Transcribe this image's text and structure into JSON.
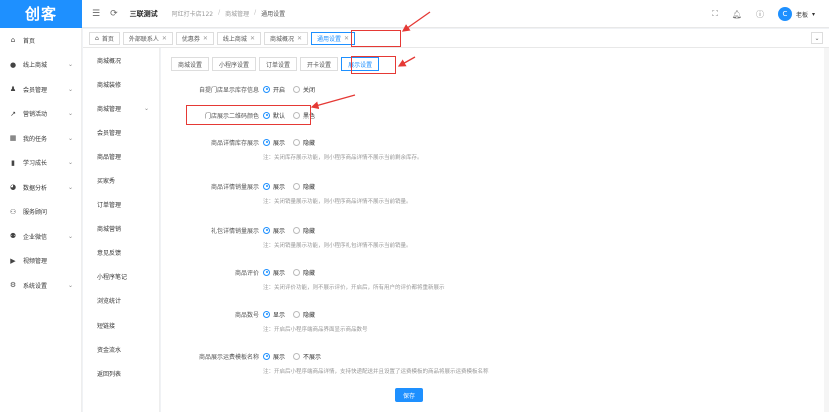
{
  "app": {
    "logo": "创客",
    "tenant": "三联测试"
  },
  "breadcrumb": [
    "阿红打卡店122",
    "商城管理",
    "通用设置"
  ],
  "user": {
    "avatar": "C",
    "name": "老板"
  },
  "sidebar": {
    "items": [
      {
        "label": "首页",
        "icon": "home-icon",
        "arrow": false
      },
      {
        "label": "线上商城",
        "icon": "shop-icon",
        "arrow": true
      },
      {
        "label": "会员管理",
        "icon": "user-icon",
        "arrow": true
      },
      {
        "label": "营销活动",
        "icon": "chart-icon",
        "arrow": true
      },
      {
        "label": "我的任务",
        "icon": "grid-icon",
        "arrow": true
      },
      {
        "label": "学习成长",
        "icon": "book-icon",
        "arrow": true
      },
      {
        "label": "数据分析",
        "icon": "pie-icon",
        "arrow": true
      },
      {
        "label": "服务顾问",
        "icon": "group-icon",
        "arrow": false
      },
      {
        "label": "企业微信",
        "icon": "team-icon",
        "arrow": true
      },
      {
        "label": "视频管理",
        "icon": "video-icon",
        "arrow": false
      },
      {
        "label": "系统设置",
        "icon": "gear-icon",
        "arrow": true
      }
    ]
  },
  "submenu": {
    "items": [
      {
        "label": "商城概况",
        "arrow": false
      },
      {
        "label": "商城装修",
        "arrow": false
      },
      {
        "label": "商城管理",
        "arrow": true
      },
      {
        "label": "会员管理",
        "arrow": false
      },
      {
        "label": "商品管理",
        "arrow": false
      },
      {
        "label": "买家秀",
        "arrow": false
      },
      {
        "label": "订单管理",
        "arrow": false
      },
      {
        "label": "商城营销",
        "arrow": false
      },
      {
        "label": "意见反馈",
        "arrow": false
      },
      {
        "label": "小程序笔记",
        "arrow": false
      },
      {
        "label": "浏览统计",
        "arrow": false
      },
      {
        "label": "短链接",
        "arrow": false
      },
      {
        "label": "资金流水",
        "arrow": false
      },
      {
        "label": "返回列表",
        "arrow": false
      }
    ]
  },
  "tabs": [
    {
      "label": "首页",
      "icon": "home-icon",
      "closable": false,
      "active": false
    },
    {
      "label": "外部联系人",
      "closable": true,
      "active": false
    },
    {
      "label": "优惠券",
      "closable": true,
      "active": false
    },
    {
      "label": "线上商城",
      "closable": true,
      "active": false
    },
    {
      "label": "商城概况",
      "closable": true,
      "active": false
    },
    {
      "label": "通用设置",
      "closable": true,
      "active": true
    }
  ],
  "subtabs": [
    {
      "label": "商城设置",
      "active": false
    },
    {
      "label": "小程序设置",
      "active": false
    },
    {
      "label": "订单设置",
      "active": false
    },
    {
      "label": "开卡设置",
      "active": false
    },
    {
      "label": "展示设置",
      "active": true
    }
  ],
  "settings": [
    {
      "label": "自提门店显示库存信息",
      "options": [
        "开启",
        "关闭"
      ],
      "selected": 0,
      "note": ""
    },
    {
      "label": "门店展示二维码颜色",
      "options": [
        "默认",
        "黑色"
      ],
      "selected": 0,
      "note": ""
    },
    {
      "label": "商品详情库存展示",
      "options": [
        "展示",
        "隐藏"
      ],
      "selected": 0,
      "note": "注：关闭库存展示功能，则小程序商品详情不展示当前剩余库存。"
    },
    {
      "label": "商品详情销量展示",
      "options": [
        "展示",
        "隐藏"
      ],
      "selected": 0,
      "note": "注：关闭销量展示功能，则小程序商品详情不展示当前销量。"
    },
    {
      "label": "礼包详情销量展示",
      "options": [
        "展示",
        "隐藏"
      ],
      "selected": 0,
      "note": "注：关闭销量展示功能，则小程序礼包详情不展示当前销量。"
    },
    {
      "label": "商品评价",
      "options": [
        "展示",
        "隐藏"
      ],
      "selected": 0,
      "note": "注：关闭评价功能，则不展示评价，开启后，所有用户的评价都将重新展示"
    },
    {
      "label": "商品数号",
      "options": [
        "显示",
        "隐藏"
      ],
      "selected": 0,
      "note": "注：开启后小程序端商品界面显示商品数号"
    },
    {
      "label": "商品展示运费模板名称",
      "options": [
        "展示",
        "不展示"
      ],
      "selected": 0,
      "note": "注：开启后小程序端商品详情，支持快递配送并且设置了运费模板的商品将展示运费模板名称"
    }
  ],
  "save_label": "保存",
  "colors": {
    "accent": "#1e90ff",
    "annotation": "#e53935"
  }
}
